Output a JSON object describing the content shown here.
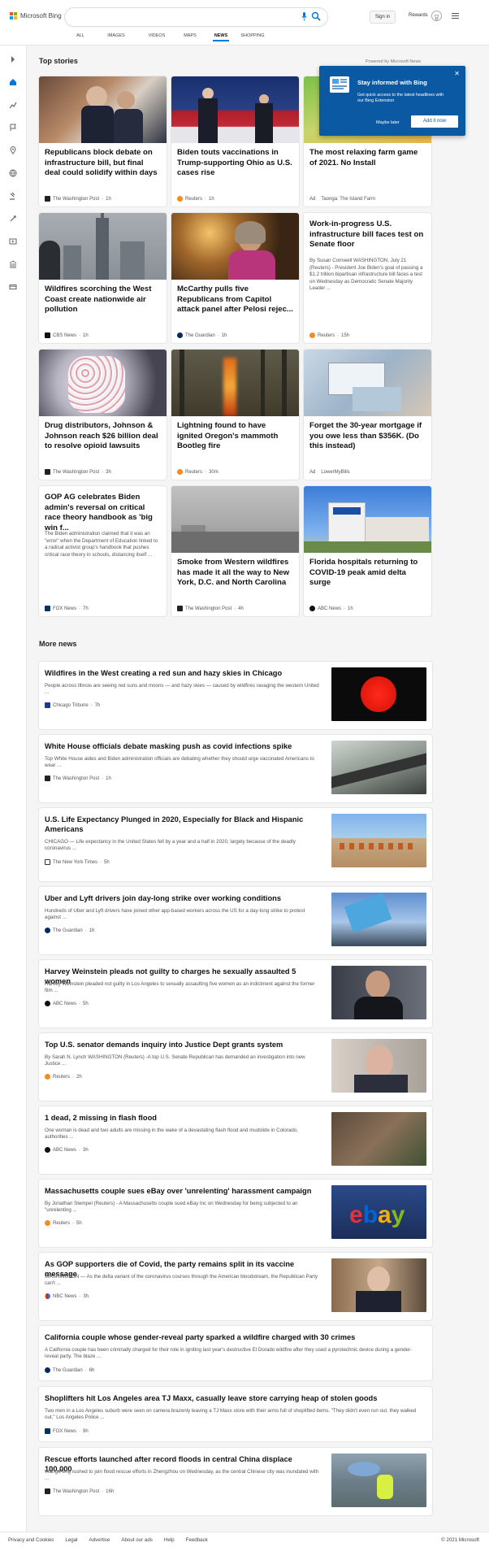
{
  "header": {
    "logo_text": "Microsoft Bing",
    "signin_label": "Sign in",
    "rewards_label": "Rewards",
    "tabs": [
      "ALL",
      "IMAGES",
      "VIDEOS",
      "MAPS",
      "NEWS",
      "SHOPPING"
    ],
    "active_tab": "NEWS"
  },
  "top_stories": {
    "title": "Top stories",
    "powered_by": "Powered by Microsoft News",
    "cards": [
      {
        "title": "Republicans block debate on infrastructure bill, but final deal could solidify within days",
        "source": "The Washington Post",
        "time": "1h"
      },
      {
        "title": "Biden touts vaccinations in Trump-supporting Ohio as U.S. cases rise",
        "source": "Reuters",
        "time": "1h"
      },
      {
        "title": "The most relaxing farm game of 2021. No Install",
        "source": "Taonga: The Island Farm",
        "ad": "Ad"
      },
      {
        "title": "Wildfires scorching the West Coast create nationwide air pollution",
        "source": "CBS News",
        "time": "1h"
      },
      {
        "title": "McCarthy pulls five Republicans from Capitol attack panel after Pelosi rejec...",
        "source": "The Guardian",
        "time": "1h"
      },
      {
        "title": "Work-in-progress U.S. infrastructure bill faces test on Senate floor",
        "desc": "By Susan Cornwell WASHINGTON, July 21 (Reuters) - President Joe Biden's goal of passing a $1.2 trillion bipartisan infrastructure bill faces a test on Wednesday as Democratic Senate Majority Leader ...",
        "source": "Reuters",
        "time": "15h"
      },
      {
        "title": "Drug distributors, Johnson & Johnson reach $26 billion deal to resolve opioid lawsuits",
        "source": "The Washington Post",
        "time": "3h"
      },
      {
        "title": "Lightning found to have ignited Oregon's mammoth Bootleg fire",
        "source": "Reuters",
        "time": "30m"
      },
      {
        "title": "Forget the 30-year mortgage if you owe less than $356K. (Do this instead)",
        "source": "LowerMyBills",
        "ad": "Ad"
      },
      {
        "title": "GOP AG celebrates Biden admin's reversal on critical race theory handbook as 'big win f...",
        "desc": "The Biden administration claimed that it was an \"error\" when the Department of Education linked to a radical activist group's handbook that pushes critical race theory in schools, distancing itself ...",
        "source": "FOX News",
        "time": "7h"
      },
      {
        "title": "Smoke from Western wildfires has made it all the way to New York, D.C. and North Carolina",
        "source": "The Washington Post",
        "time": "4h"
      },
      {
        "title": "Florida hospitals returning to COVID-19 peak amid delta surge",
        "source": "ABC News",
        "time": "1h"
      }
    ]
  },
  "popup": {
    "title": "Stay informed with Bing",
    "desc": "Get quick access to the latest headlines with our Bing Extension",
    "later": "Maybe later",
    "add": "Add it now"
  },
  "more_news": {
    "title": "More news",
    "items": [
      {
        "title": "Wildfires in the West creating a red sun and hazy skies in Chicago",
        "desc": "People across Illinois are seeing red suns and moons — and hazy skies — caused by wildfires ravaging the western United ...",
        "source": "Chicago Tribune",
        "time": "7h"
      },
      {
        "title": "White House officials debate masking push as covid infections spike",
        "desc": "Top White House aides and Biden administration officials are debating whether they should urge vaccinated Americans to wear ...",
        "source": "The Washington Post",
        "time": "1h"
      },
      {
        "title": "U.S. Life Expectancy Plunged in 2020, Especially for Black and Hispanic Americans",
        "desc": "CHICAGO — Life expectancy in the United States fell by a year and a half in 2020, largely because of the deadly coronavirus ...",
        "source": "The New York Times",
        "time": "5h"
      },
      {
        "title": "Uber and Lyft drivers join day-long strike over working conditions",
        "desc": "Hundreds of Uber and Lyft drivers have joined other app-based workers across the US for a day-long strike to protest against ...",
        "source": "The Guardian",
        "time": "1h"
      },
      {
        "title": "Harvey Weinstein pleads not guilty to charges he sexually assaulted 5 women",
        "desc": "Harvey Weinstein pleaded not guilty in Los Angeles to sexually assaulting five women as an indictment against the former film ...",
        "source": "ABC News",
        "time": "5h"
      },
      {
        "title": "Top U.S. senator demands inquiry into Justice Dept grants system",
        "desc": "By Sarah N. Lynch WASHINGTON (Reuters) -A top U.S. Senate Republican has demanded an investigation into new Justice ...",
        "source": "Reuters",
        "time": "2h"
      },
      {
        "title": "1 dead, 2 missing in flash flood",
        "desc": "One woman is dead and two adults are missing in the wake of a devastating flash flood and mudslide in Colorado, authorities ...",
        "source": "ABC News",
        "time": "3h"
      },
      {
        "title": "Massachusetts couple sues eBay over 'unrelenting' harassment campaign",
        "desc": "By Jonathan Stempel (Reuters) - A Massachusetts couple sued eBay Inc on Wednesday for being subjected to an \"unrelenting ...",
        "source": "Reuters",
        "time": "5h"
      },
      {
        "title": "As GOP supporters die of Covid, the party remains split in its vaccine message",
        "desc": "WASHINGTON — As the delta variant of the coronavirus courses through the American bloodstream, the Republican Party can't ...",
        "source": "NBC News",
        "time": "3h"
      },
      {
        "title": "California couple whose gender-reveal party sparked a wildfire charged with 30 crimes",
        "desc": "A California couple has been criminally charged for their role in igniting last year's destructive El Dorado wildfire after they used a pyrotechnic device during a gender-reveal party. The blaze ...",
        "source": "The Guardian",
        "time": "6h"
      },
      {
        "title": "Shoplifters hit Los Angeles area TJ Maxx, casually leave store carrying heap of stolen goods",
        "desc": "Two men in a Los Angeles suburb were seen on camera brazenly leaving a TJ Maxx store with their arms full of shoplifted items. \"They didn't even run out, they walked out,\" Los Angeles Police ...",
        "source": "FOX News",
        "time": "9h"
      },
      {
        "title": "Rescue efforts launched after record floods in central China displace 100,000",
        "desc": "Wang Peng rushed to join flood rescue efforts in Zhengzhou on Wednesday, as the central Chinese city was inundated with ...",
        "source": "The Washington Post",
        "time": "16h"
      }
    ]
  },
  "footer": {
    "links": [
      "Privacy and Cookies",
      "Legal",
      "Advertise",
      "About our ads",
      "Help",
      "Feedback"
    ],
    "copyright": "© 2021 Microsoft"
  }
}
